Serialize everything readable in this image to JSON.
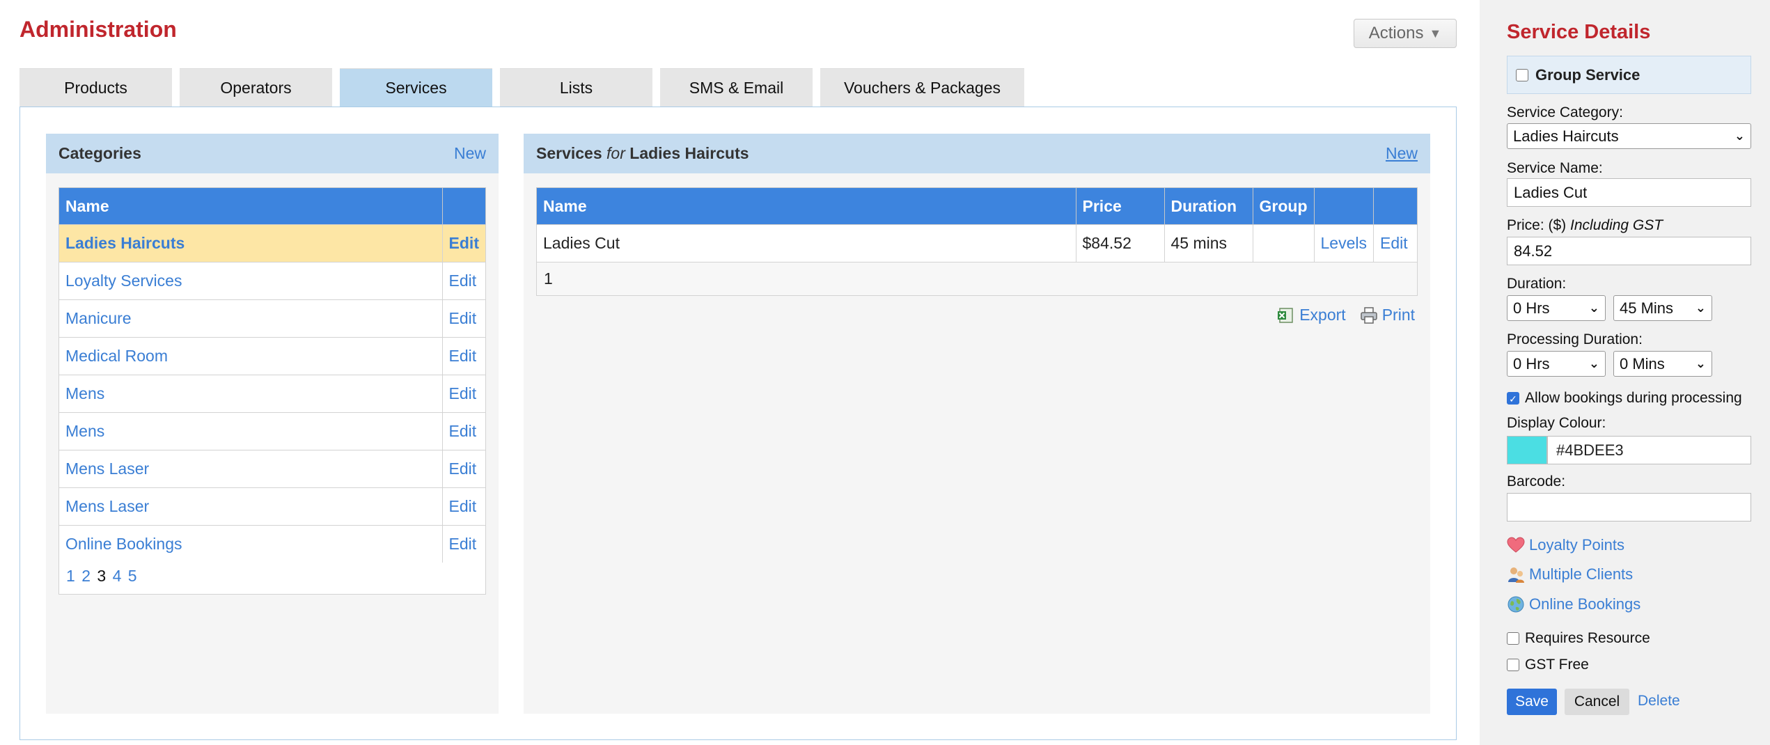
{
  "header": {
    "title": "Administration",
    "actions_label": "Actions",
    "actions_arrow": "▼"
  },
  "tabs": [
    {
      "label": "Products",
      "active": false
    },
    {
      "label": "Operators",
      "active": false
    },
    {
      "label": "Services",
      "active": true
    },
    {
      "label": "Lists",
      "active": false
    },
    {
      "label": "SMS & Email",
      "active": false
    },
    {
      "label": "Vouchers & Packages",
      "active": false
    }
  ],
  "categories": {
    "title": "Categories",
    "new_label": "New",
    "column_name": "Name",
    "edit_label": "Edit",
    "rows": [
      {
        "name": "Ladies Haircuts",
        "selected": true
      },
      {
        "name": "Loyalty Services"
      },
      {
        "name": "Manicure"
      },
      {
        "name": "Medical Room"
      },
      {
        "name": "Mens"
      },
      {
        "name": "Mens"
      },
      {
        "name": "Mens Laser"
      },
      {
        "name": "Mens Laser"
      },
      {
        "name": "Online Bookings"
      }
    ],
    "pages": [
      "1",
      "2",
      "3",
      "4",
      "5"
    ],
    "current_page": "3"
  },
  "services": {
    "title_prefix": "Services",
    "title_for": "for",
    "title_category": "Ladies Haircuts",
    "new_label": "New",
    "columns": [
      "Name",
      "Price",
      "Duration",
      "Group",
      "",
      ""
    ],
    "rows": [
      {
        "name": "Ladies Cut",
        "price": "$84.52",
        "duration": "45 mins",
        "group": "",
        "levels": "Levels",
        "edit": "Edit"
      }
    ],
    "footer_page": "1",
    "export_label": "Export",
    "print_label": "Print"
  },
  "details": {
    "title": "Service Details",
    "group_service_label": "Group Service",
    "category_label": "Service Category:",
    "category_value": "Ladies Haircuts",
    "name_label": "Service Name:",
    "name_value": "Ladies Cut",
    "price_label": "Price: ($)",
    "price_note": "Including GST",
    "price_value": "84.52",
    "duration_label": "Duration:",
    "duration_hrs": "0 Hrs",
    "duration_mins": "45 Mins",
    "processing_label": "Processing Duration:",
    "processing_hrs": "0 Hrs",
    "processing_mins": "0 Mins",
    "allow_processing_label": "Allow bookings during processing",
    "allow_processing_checked": true,
    "colour_label": "Display Colour:",
    "colour_value": "#4BDEE3",
    "barcode_label": "Barcode:",
    "barcode_value": "",
    "loyalty_label": "Loyalty Points",
    "multiple_clients_label": "Multiple Clients",
    "online_bookings_label": "Online Bookings",
    "requires_resource_label": "Requires Resource",
    "gst_free_label": "GST Free",
    "save_label": "Save",
    "cancel_label": "Cancel",
    "delete_label": "Delete"
  },
  "colors": {
    "accent_red": "#c0262d",
    "link_blue": "#3a7ed4",
    "header_blue": "#3d84de",
    "selected_row": "#fde6a5",
    "swatch": "#4bdee3"
  }
}
